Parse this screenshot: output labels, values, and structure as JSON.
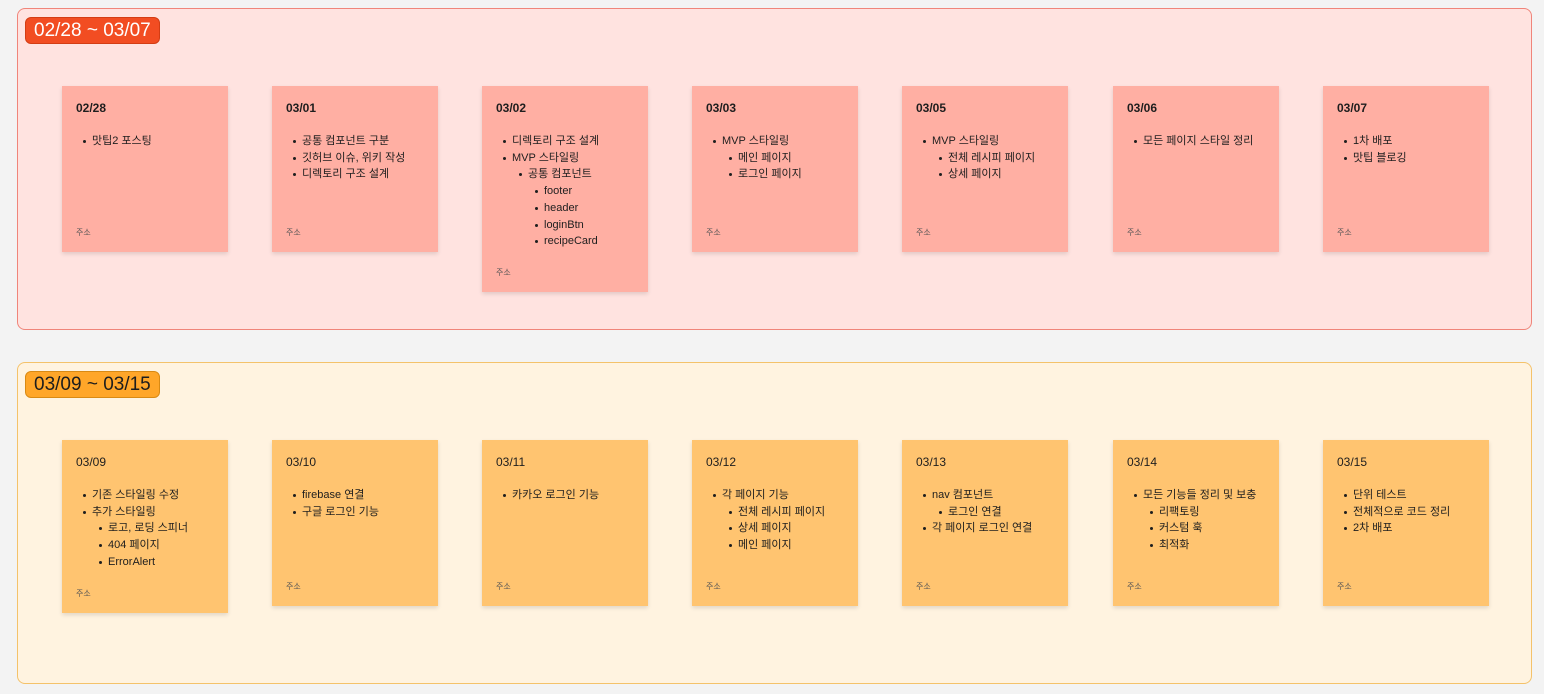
{
  "sections": [
    {
      "label": "02/28 ~ 03/07",
      "color": "#f24d22",
      "notes": [
        {
          "date": "02/28",
          "items": [
            {
              "text": "맛팁2 포스팅"
            }
          ],
          "footer": "주소"
        },
        {
          "date": "03/01",
          "items": [
            {
              "text": "공통 컴포넌트 구분"
            },
            {
              "text": "깃허브 이슈, 위키 작성"
            },
            {
              "text": "디렉토리 구조 설계"
            }
          ],
          "footer": "주소"
        },
        {
          "date": "03/02",
          "items": [
            {
              "text": "디렉토리 구조 설계"
            },
            {
              "text": "MVP 스타일링",
              "children": [
                {
                  "text": "공통 컴포넌트",
                  "children": [
                    {
                      "text": "footer"
                    },
                    {
                      "text": "header"
                    },
                    {
                      "text": "loginBtn"
                    },
                    {
                      "text": "recipeCard"
                    }
                  ]
                }
              ]
            }
          ],
          "footer": "주소"
        },
        {
          "date": "03/03",
          "items": [
            {
              "text": "MVP 스타일링",
              "children": [
                {
                  "text": "메인 페이지"
                },
                {
                  "text": "로그인 페이지"
                }
              ]
            }
          ],
          "footer": "주소"
        },
        {
          "date": "03/05",
          "items": [
            {
              "text": "MVP 스타일링",
              "children": [
                {
                  "text": "전체 레시피  페이지"
                },
                {
                  "text": "상세 페이지"
                }
              ]
            }
          ],
          "footer": "주소"
        },
        {
          "date": "03/06",
          "items": [
            {
              "text": "모든 페이지 스타일 정리"
            }
          ],
          "footer": "주소"
        },
        {
          "date": "03/07",
          "items": [
            {
              "text": "1차 배포"
            },
            {
              "text": "맛팁 블로깅"
            }
          ],
          "footer": "주소"
        }
      ]
    },
    {
      "label": "03/09 ~ 03/15",
      "color": "#ffa629",
      "notes": [
        {
          "date": "03/09",
          "items": [
            {
              "text": "기존 스타일링 수정"
            },
            {
              "text": "추가 스타일링",
              "children": [
                {
                  "text": "로고, 로딩 스피너"
                },
                {
                  "text": "404 페이지"
                },
                {
                  "text": "ErrorAlert"
                }
              ]
            }
          ],
          "footer": "주소"
        },
        {
          "date": "03/10",
          "items": [
            {
              "text": "firebase 연결"
            },
            {
              "text": "구글 로그인 기능"
            }
          ],
          "footer": "주소"
        },
        {
          "date": "03/11",
          "items": [
            {
              "text": "카카오 로그인 기능"
            }
          ],
          "footer": "주소"
        },
        {
          "date": "03/12",
          "items": [
            {
              "text": "각 페이지 기능",
              "children": [
                {
                  "text": "전체 레시피 페이지"
                },
                {
                  "text": "상세 페이지"
                },
                {
                  "text": "메인 페이지"
                }
              ]
            }
          ],
          "footer": "주소"
        },
        {
          "date": "03/13",
          "items": [
            {
              "text": "nav 컴포넌트",
              "children": [
                {
                  "text": "로그인 연결"
                }
              ]
            },
            {
              "text": "각 페이지 로그인 연결"
            }
          ],
          "footer": "주소"
        },
        {
          "date": "03/14",
          "items": [
            {
              "text": "모든 기능들 정리 및 보충",
              "children": [
                {
                  "text": "리팩토링"
                },
                {
                  "text": "커스텀 훅"
                },
                {
                  "text": "최적화"
                }
              ]
            }
          ],
          "footer": "주소"
        },
        {
          "date": "03/15",
          "items": [
            {
              "text": "단위 테스트"
            },
            {
              "text": "전체적으로 코드 정리"
            },
            {
              "text": "2차 배포"
            }
          ],
          "footer": "주소"
        }
      ]
    }
  ]
}
